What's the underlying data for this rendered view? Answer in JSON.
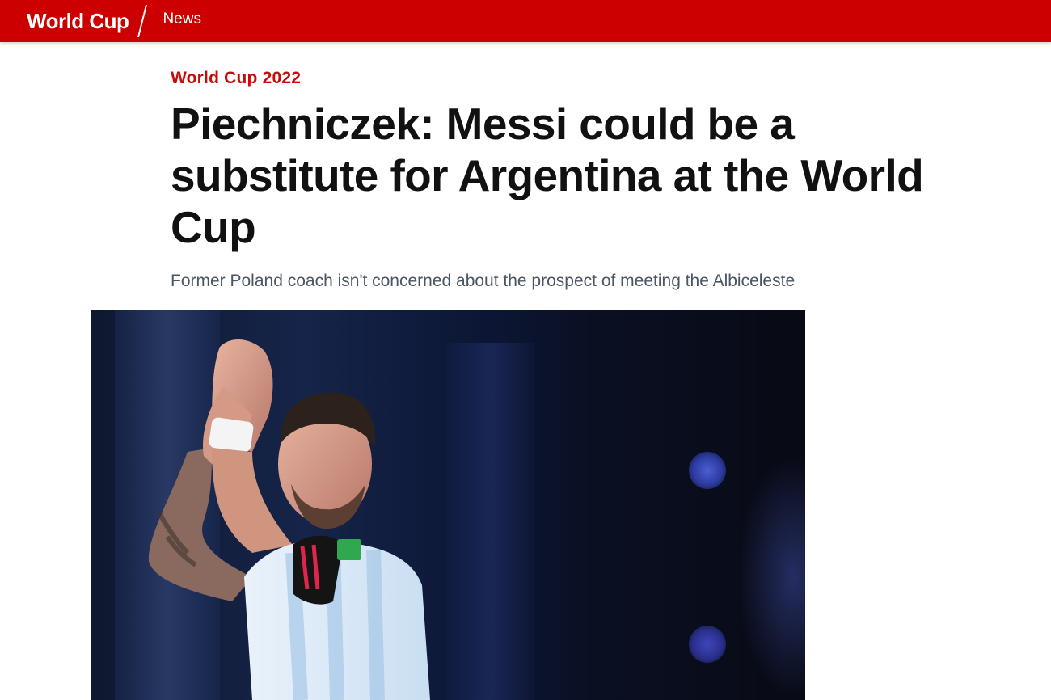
{
  "topbar": {
    "brand": "World Cup",
    "nav_link": "News",
    "color": "#cc0000"
  },
  "article": {
    "category": "World Cup 2022",
    "headline": "Piechniczek: Messi could be a substitute for Argentina at the World Cup",
    "subtitle": "Former Poland coach isn't concerned about the prospect of meeting the Albiceleste",
    "category_color": "#c80a0a"
  },
  "hero_image": {
    "kind": "photo of football player applauding in light blue and white striped jersey"
  }
}
